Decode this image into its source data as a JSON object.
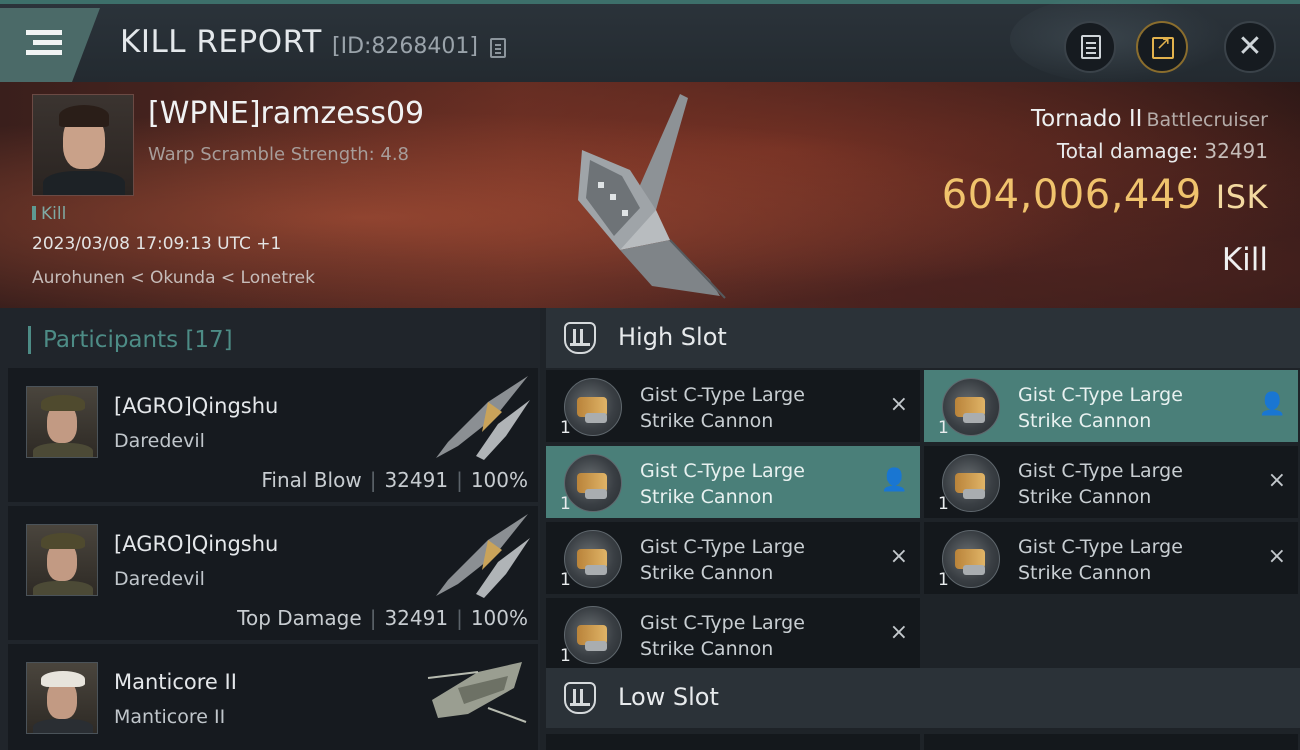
{
  "header": {
    "title": "KILL REPORT",
    "report_id": "[ID:8268401]"
  },
  "victim": {
    "name": "[WPNE]ramzess09",
    "subtitle": "Warp Scramble Strength: 4.8",
    "tag": "Kill",
    "datetime": "2023/03/08 17:09:13 UTC +1",
    "location": "Aurohunen < Okunda < Lonetrek",
    "ship": "Tornado II",
    "ship_class": "Battlecruiser",
    "total_damage_label": "Total damage:",
    "total_damage": "32491",
    "isk_value": "604,006,449",
    "isk_unit": "ISK",
    "result": "Kill"
  },
  "participants": {
    "title": "Participants [17]",
    "items": [
      {
        "name": "[AGRO]Qingshu",
        "ship": "Daredevil",
        "role": "Final Blow",
        "damage": "32491",
        "percent": "100%"
      },
      {
        "name": "[AGRO]Qingshu",
        "ship": "Daredevil",
        "role": "Top Damage",
        "damage": "32491",
        "percent": "100%"
      },
      {
        "name": "Manticore II",
        "ship": "Manticore II"
      }
    ]
  },
  "slots": {
    "high_label": "High Slot",
    "low_label": "Low Slot",
    "high": [
      {
        "line1": "Gist C-Type Large",
        "line2": "Strike Cannon",
        "qty": "1",
        "status": "×",
        "status_icon": "close-icon"
      },
      {
        "line1": "Gist C-Type Large",
        "line2": "Strike Cannon",
        "qty": "1",
        "status": "👤",
        "status_icon": "person-icon"
      },
      {
        "line1": "Gist C-Type Large",
        "line2": "Strike Cannon",
        "qty": "1",
        "status": "👤",
        "status_icon": "person-icon"
      },
      {
        "line1": "Gist C-Type Large",
        "line2": "Strike Cannon",
        "qty": "1",
        "status": "×",
        "status_icon": "close-icon"
      },
      {
        "line1": "Gist C-Type Large",
        "line2": "Strike Cannon",
        "qty": "1",
        "status": "×",
        "status_icon": "close-icon"
      },
      {
        "line1": "Gist C-Type Large",
        "line2": "Strike Cannon",
        "qty": "1",
        "status": "×",
        "status_icon": "close-icon"
      },
      {
        "line1": "Gist C-Type Large",
        "line2": "Strike Cannon",
        "qty": "1",
        "status": "×",
        "status_icon": "close-icon"
      }
    ]
  },
  "colors": {
    "accent_teal": "#4a7f79",
    "isk_gold": "#f0c36d"
  }
}
